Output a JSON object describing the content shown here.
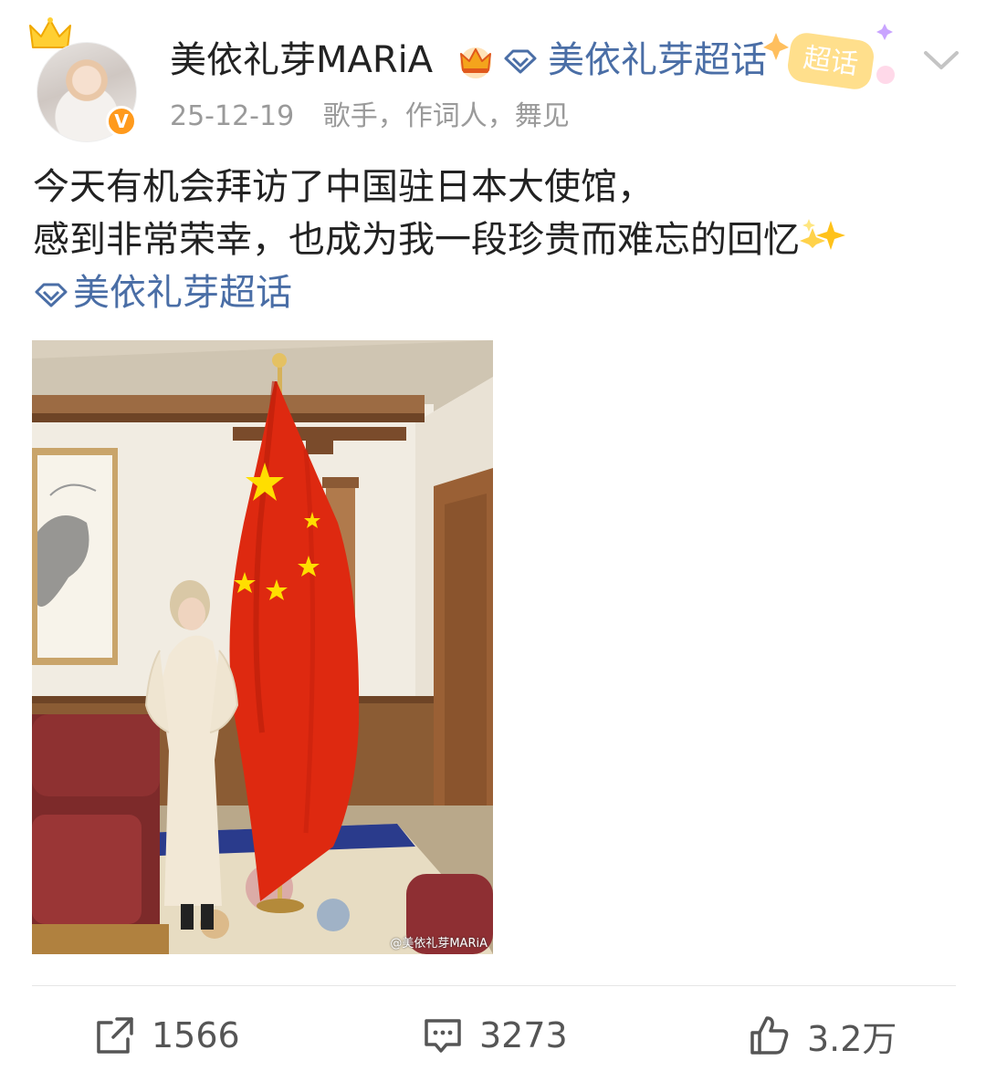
{
  "post": {
    "author": {
      "name": "美依礼芽MARiA",
      "verified_icon": "verified-v-icon",
      "badge_icon": "crown-icon"
    },
    "topic_link": "美依礼芽超话",
    "topic_tag": "超话",
    "date": "25-12-19",
    "source": "歌手，作词人，舞见",
    "text_lines": [
      "今天有机会拜访了中国驻日本大使馆，",
      "感到非常荣幸，也成为我一段珍贵而难忘的回忆"
    ],
    "text_emoji": "sparkles-emoji",
    "text_topic": "美依礼芽超话",
    "image": {
      "watermark": "@美依礼芽MARiA"
    }
  },
  "actions": {
    "repost_count": "1566",
    "comment_count": "3273",
    "like_count": "3.2万"
  },
  "colors": {
    "link": "#4a6ea6",
    "verified": "#ff9a1c",
    "meta": "#9a9a9a",
    "flag_red": "#de2910",
    "flag_star": "#ffde00"
  }
}
